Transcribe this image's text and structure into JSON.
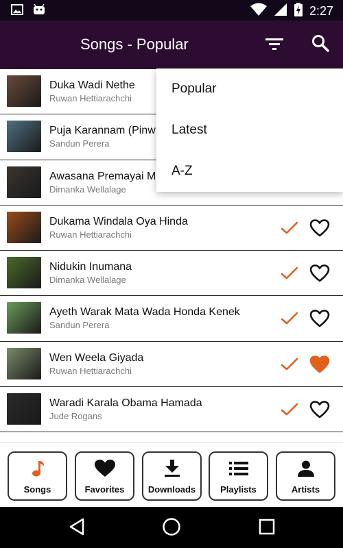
{
  "status_bar": {
    "time": "2:27",
    "left_icons": [
      "image-icon",
      "android-icon"
    ],
    "right_icons": [
      "wifi-icon",
      "cell-signal-icon",
      "battery-charging-icon"
    ]
  },
  "app_bar": {
    "title": "Songs - Popular",
    "actions": [
      "filter-icon",
      "search-icon"
    ]
  },
  "sort_menu": {
    "items": [
      "Popular",
      "Latest",
      "A-Z"
    ]
  },
  "songs": [
    {
      "title": "Duka Wadi Nethe",
      "artist": "Ruwan Hettiarachchi",
      "downloaded": true,
      "favorite": false,
      "thumb_color": "#6a4a3a"
    },
    {
      "title": "Puja Karannam (Pinw",
      "artist": "Sandun Perera",
      "downloaded": true,
      "favorite": false,
      "thumb_color": "#4f7080"
    },
    {
      "title": "Awasana Premayai M",
      "artist": "Dimanka Wellalage",
      "downloaded": true,
      "favorite": false,
      "thumb_color": "#3a3430"
    },
    {
      "title": "Dukama Windala Oya Hinda",
      "artist": "Ruwan Hettiarachchi",
      "downloaded": true,
      "favorite": false,
      "thumb_color": "#9a4a1a"
    },
    {
      "title": "Nidukin Inumana",
      "artist": "Dimanka Wellalage",
      "downloaded": true,
      "favorite": false,
      "thumb_color": "#4a6a2a"
    },
    {
      "title": "Ayeth Warak Mata Wada Honda Kenek",
      "artist": "Sandun Perera",
      "downloaded": true,
      "favorite": false,
      "thumb_color": "#6a9a5a"
    },
    {
      "title": "Wen Weela Giyada",
      "artist": "Ruwan Hettiarachchi",
      "downloaded": true,
      "favorite": true,
      "thumb_color": "#7a8a6a"
    },
    {
      "title": "Waradi Karala Obama Hamada",
      "artist": "Jude Rogans",
      "downloaded": true,
      "favorite": false,
      "thumb_color": "#2a2a2a"
    }
  ],
  "bottom_nav": [
    {
      "label": "Songs",
      "icon": "music-note-icon",
      "active": true
    },
    {
      "label": "Favorites",
      "icon": "heart-icon",
      "active": false
    },
    {
      "label": "Downloads",
      "icon": "download-icon",
      "active": false
    },
    {
      "label": "Playlists",
      "icon": "list-icon",
      "active": false
    },
    {
      "label": "Artists",
      "icon": "person-icon",
      "active": false
    }
  ],
  "system_nav": [
    "back-icon",
    "home-icon",
    "recents-icon"
  ],
  "colors": {
    "app_bar": "#2d0c32",
    "status_bar": "#12081a",
    "accent": "#e0601c",
    "text": "#111111",
    "subtext": "#7a7a7a"
  }
}
